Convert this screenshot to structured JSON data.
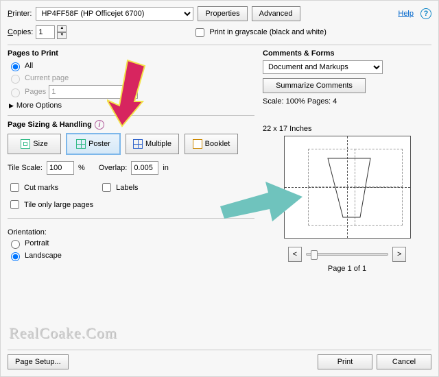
{
  "top": {
    "printer_label": "Printer:",
    "printer_label_hot": "P",
    "printer_value": "HP4FF58F (HP Officejet 6700)",
    "properties_btn": "Properties",
    "advanced_btn": "Advanced",
    "help": "Help",
    "copies_label": "Copies:",
    "copies_label_hot": "C",
    "copies_value": "1",
    "grayscale": "Print in grayscale (black and white)"
  },
  "pages": {
    "title": "Pages to Print",
    "all": "All",
    "current": "Current page",
    "pages_label": "Pages",
    "pages_value": "1",
    "more": "More Options"
  },
  "sizing": {
    "title": "Page Sizing & Handling",
    "size": "Size",
    "poster": "Poster",
    "multiple": "Multiple",
    "booklet": "Booklet",
    "tile_scale_label": "Tile Scale:",
    "tile_scale_value": "100",
    "percent": "%",
    "overlap_label": "Overlap:",
    "overlap_value": "0.005",
    "overlap_unit": "in",
    "cut_marks": "Cut marks",
    "labels": "Labels",
    "tile_large": "Tile only large pages"
  },
  "orientation": {
    "title": "Orientation:",
    "portrait": "Portrait",
    "landscape": "Landscape"
  },
  "comments": {
    "title": "Comments & Forms",
    "value": "Document and Markups",
    "summarize": "Summarize Comments"
  },
  "preview": {
    "scale_line": "Scale: 100% Pages: 4",
    "dims": "22 x 17 Inches",
    "pager_prev": "<",
    "pager_next": ">",
    "page_of": "Page 1 of 1"
  },
  "footer": {
    "page_setup": "Page Setup...",
    "print": "Print",
    "cancel": "Cancel"
  },
  "watermark": "RealCoake.Com"
}
